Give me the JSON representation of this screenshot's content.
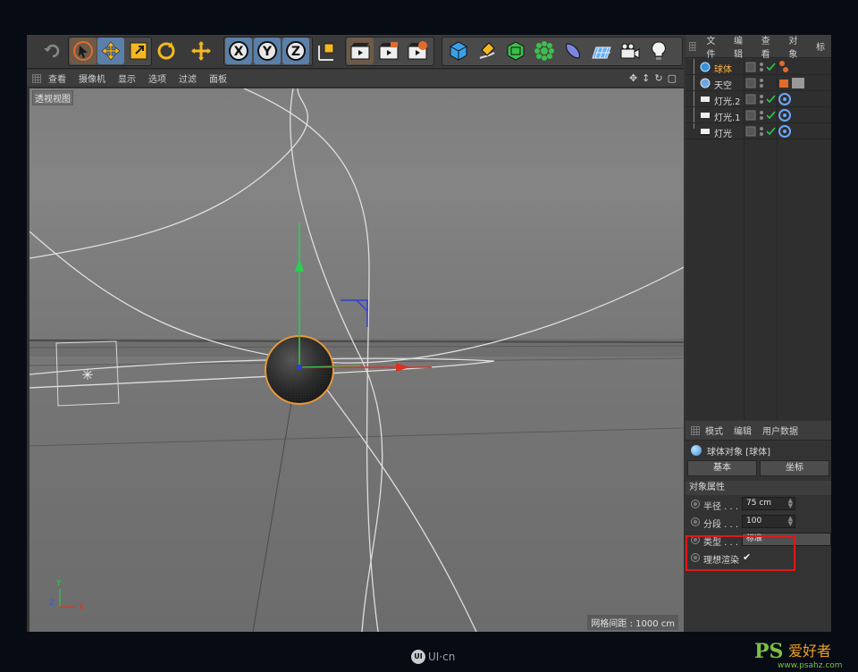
{
  "toolbar": {
    "icons": [
      "undo-icon",
      "live-select-icon",
      "move-icon",
      "scale-icon",
      "rotate-icon",
      "move-alt-icon",
      "x-axis-icon",
      "y-axis-icon",
      "z-axis-icon",
      "coord-system-icon",
      "render-view-icon",
      "render-picture-icon",
      "render-settings-icon",
      "cube-icon",
      "pen-icon",
      "subdivision-icon",
      "cloner-icon",
      "deformer-icon",
      "floor-icon",
      "camera-icon",
      "light-icon"
    ],
    "axis_x": "X",
    "axis_y": "Y",
    "axis_z": "Z"
  },
  "viewport": {
    "menu": [
      "查看",
      "摄像机",
      "显示",
      "选项",
      "过滤",
      "面板"
    ],
    "label": "透视视图",
    "grid_readout": "网格间距 : 1000 cm",
    "axis_x": "X",
    "axis_y": "Y",
    "axis_z": "Z"
  },
  "object_manager": {
    "menu": [
      "文件",
      "编辑",
      "查看",
      "对象",
      "标"
    ],
    "objects": [
      {
        "name": "球体",
        "active": true
      },
      {
        "name": "天空",
        "active": false
      },
      {
        "name": "灯光.2",
        "active": false
      },
      {
        "name": "灯光.1",
        "active": false
      },
      {
        "name": "灯光",
        "active": false
      }
    ]
  },
  "attributes": {
    "menu": [
      "模式",
      "编辑",
      "用户数据"
    ],
    "title": "球体对象 [球体]",
    "tabs": [
      "基本",
      "坐标"
    ],
    "section": "对象属性",
    "params": [
      {
        "label": "半径 . . .",
        "value": "75 cm"
      },
      {
        "label": "分段 . . .",
        "value": "100"
      },
      {
        "label": "类型 . . .",
        "value": "标准"
      },
      {
        "label": "理想渲染",
        "value": "✔"
      }
    ]
  },
  "watermark": {
    "uicn": "UI·cn",
    "ps_logo": "PS",
    "ps_text": "爱好者",
    "ps_url": "www.psahz.com"
  },
  "colors": {
    "accent_orange": "#ffb040",
    "highlight_red": "#e01818",
    "active_blue": "#5a7fa8"
  }
}
